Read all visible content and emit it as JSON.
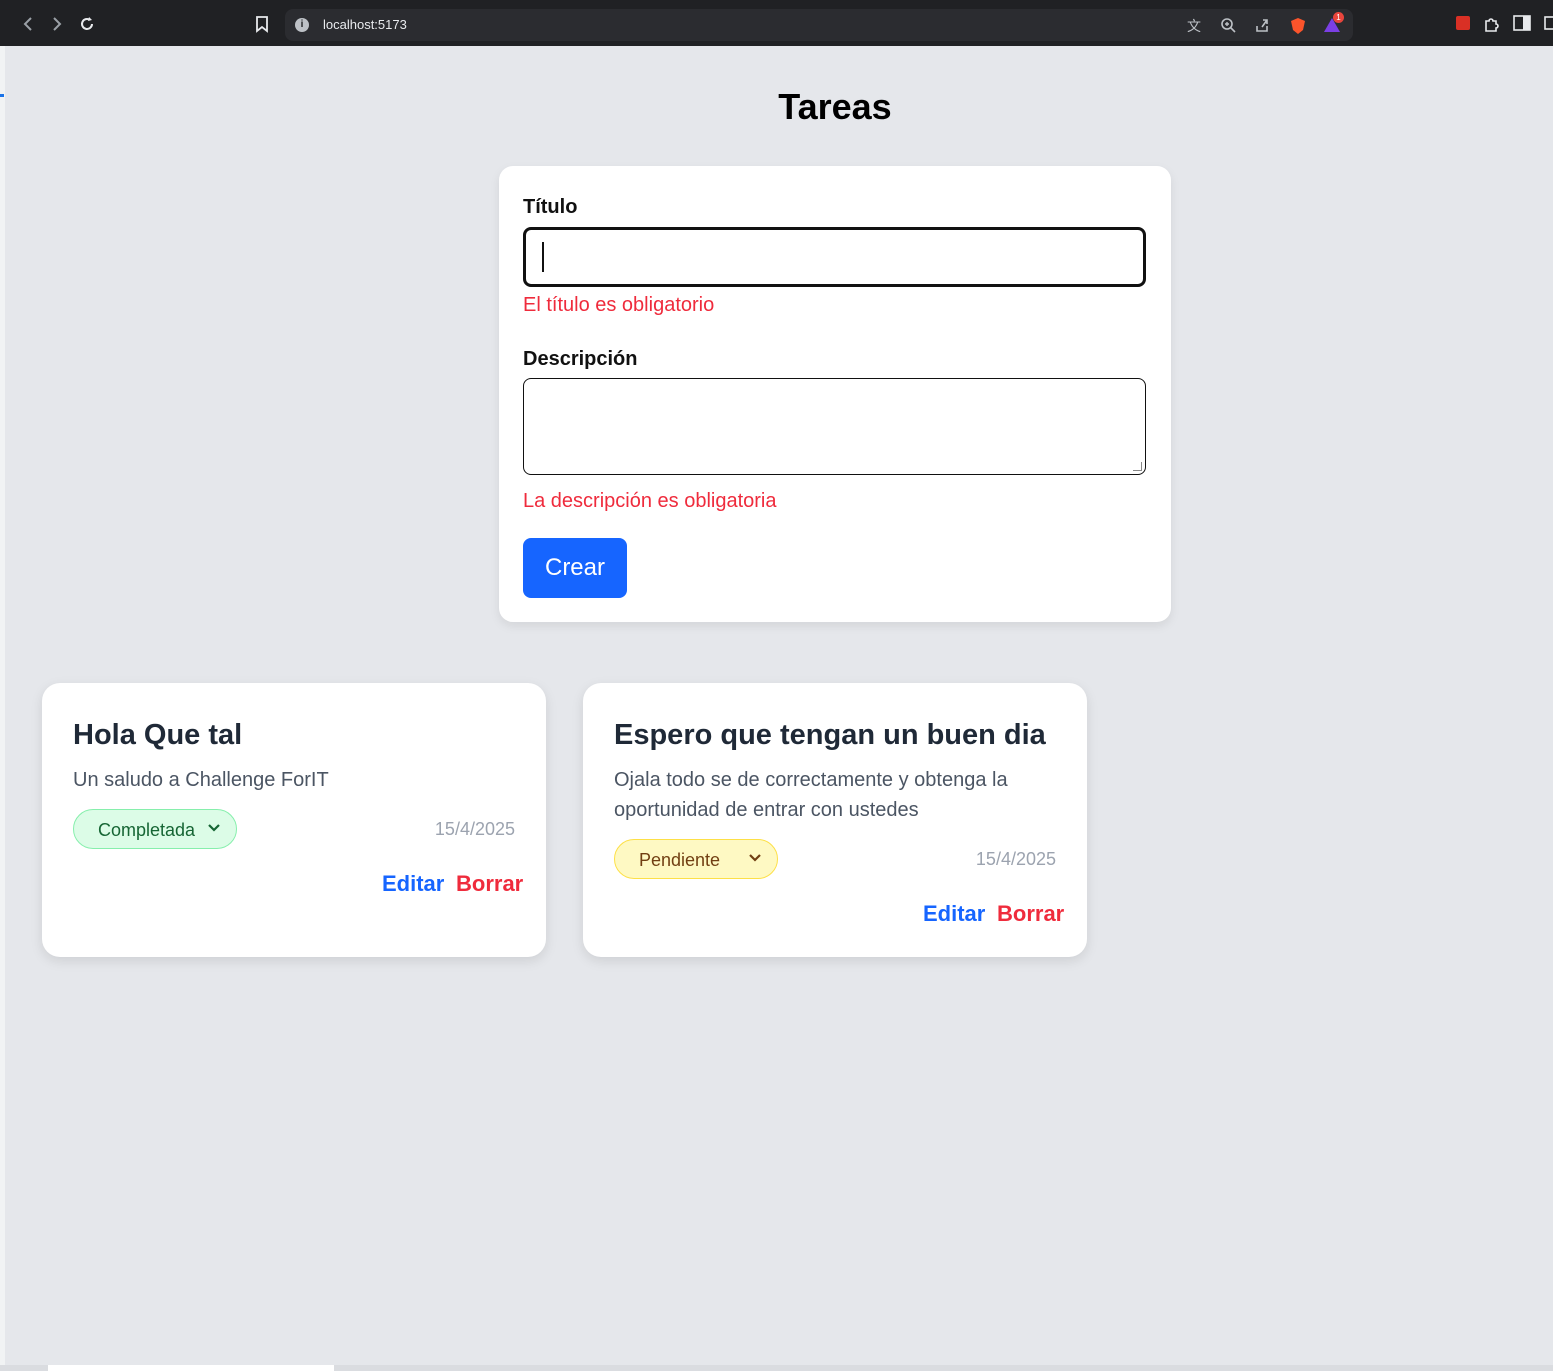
{
  "browser": {
    "url": "localhost:5173",
    "notification_badge": "1"
  },
  "page": {
    "title": "Tareas"
  },
  "form": {
    "title_label": "Título",
    "title_value": "",
    "title_error": "El título es obligatorio",
    "description_label": "Descripción",
    "description_value": "",
    "description_error": "La descripción es obligatoria",
    "submit_label": "Crear"
  },
  "tasks": [
    {
      "title": "Hola Que tal",
      "description": "Un saludo a Challenge ForIT",
      "status": "Completada",
      "date": "15/4/2025",
      "edit_label": "Editar",
      "delete_label": "Borrar"
    },
    {
      "title": "Espero que tengan un buen dia",
      "description": "Ojala todo se de correctamente y obtenga la oportunidad de entrar con ustedes",
      "status": "Pendiente",
      "date": "15/4/2025",
      "edit_label": "Editar",
      "delete_label": "Borrar"
    }
  ],
  "colors": {
    "background": "#e5e7eb",
    "primary": "#1665ff",
    "danger": "#ef2b3c",
    "completed_bg": "#dcfce7",
    "pending_bg": "#fef9c3"
  }
}
